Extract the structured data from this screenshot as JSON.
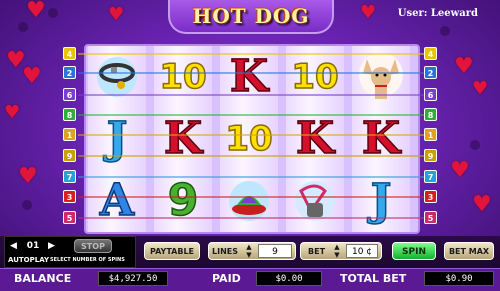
{
  "game": {
    "title": "HOT DOG",
    "user": "User: Leeward"
  },
  "lines_left": [
    "4",
    "2",
    "6",
    "8",
    "1",
    "9",
    "7",
    "3",
    "5"
  ],
  "lines_right": [
    "4",
    "2",
    "6",
    "8",
    "1",
    "9",
    "7",
    "3",
    "5"
  ],
  "line_colors": {
    "1": "#e0a020",
    "2": "#2b73d8",
    "3": "#d81e1e",
    "4": "#e8c400",
    "5": "#cc2a6a",
    "6": "#7a3fd0",
    "7": "#2a9fd8",
    "8": "#2fae3a",
    "9": "#c8a000"
  },
  "reels": [
    {
      "symbols": [
        {
          "icon": "dog-collar-icon",
          "text": ""
        },
        {
          "icon": "",
          "text": "J"
        },
        {
          "icon": "",
          "text": "A"
        }
      ]
    },
    {
      "symbols": [
        {
          "icon": "",
          "text": "10"
        },
        {
          "icon": "",
          "text": "K"
        },
        {
          "icon": "",
          "text": "9"
        }
      ]
    },
    {
      "symbols": [
        {
          "icon": "",
          "text": "K"
        },
        {
          "icon": "",
          "text": "10"
        },
        {
          "icon": "dog-bed-icon",
          "text": ""
        }
      ]
    },
    {
      "symbols": [
        {
          "icon": "",
          "text": "10"
        },
        {
          "icon": "",
          "text": "K"
        },
        {
          "icon": "dog-leash-icon",
          "text": ""
        }
      ]
    },
    {
      "symbols": [
        {
          "icon": "chihuahua-dog-icon",
          "text": ""
        },
        {
          "icon": "",
          "text": "K"
        },
        {
          "icon": "",
          "text": "J"
        }
      ]
    }
  ],
  "controls": {
    "autoplay_value": "01",
    "stop_label": "STOP",
    "autoplay_label": "AUTOPLAY",
    "autoplay_hint": "SELECT NUMBER OF SPINS",
    "paytable_label": "PAYTABLE",
    "lines_label": "LINES",
    "lines_value": "9",
    "bet_label": "BET",
    "bet_value": "10 ¢",
    "spin_label": "SPIN",
    "betmax_label": "BET MAX"
  },
  "status": {
    "balance_label": "BALANCE",
    "balance_value": "$4,927.50",
    "paid_label": "PAID",
    "paid_value": "$0.00",
    "totalbet_label": "TOTAL BET",
    "totalbet_value": "$0.90"
  },
  "colors": {
    "accent_green": "#2fd34a",
    "bar_purple": "#5b1a94",
    "frame_purple": "#6a23b3"
  }
}
